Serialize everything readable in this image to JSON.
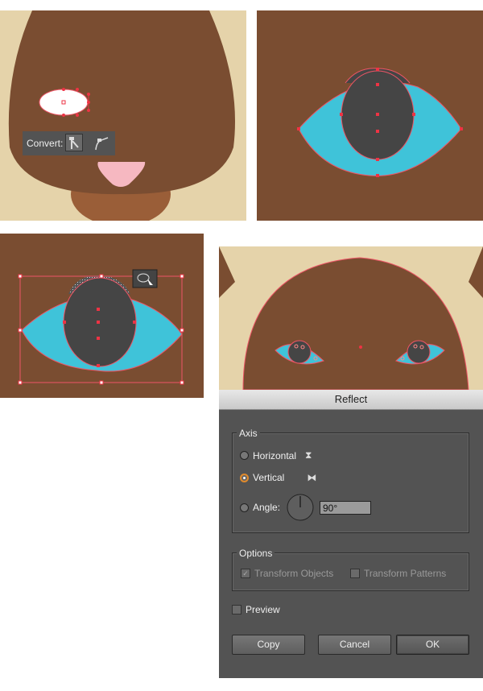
{
  "colors": {
    "brown": "#7a4d31",
    "tan": "#e5d3aa",
    "cyan": "#3fc3d9",
    "pupil": "#454545",
    "nose": "#f6b8c1",
    "selection": "#ee3344"
  },
  "convert_bar": {
    "label": "Convert:",
    "icons": [
      "convert-to-corner-icon",
      "convert-to-smooth-icon"
    ]
  },
  "dialog": {
    "title": "Reflect",
    "axis": {
      "legend": "Axis",
      "horizontal": "Horizontal",
      "vertical": "Vertical",
      "angle_label": "Angle:",
      "angle_value": "90°",
      "selected": "vertical"
    },
    "options": {
      "legend": "Options",
      "transform_objects": "Transform Objects",
      "transform_patterns": "Transform Patterns"
    },
    "preview": "Preview",
    "buttons": {
      "copy": "Copy",
      "cancel": "Cancel",
      "ok": "OK"
    }
  }
}
